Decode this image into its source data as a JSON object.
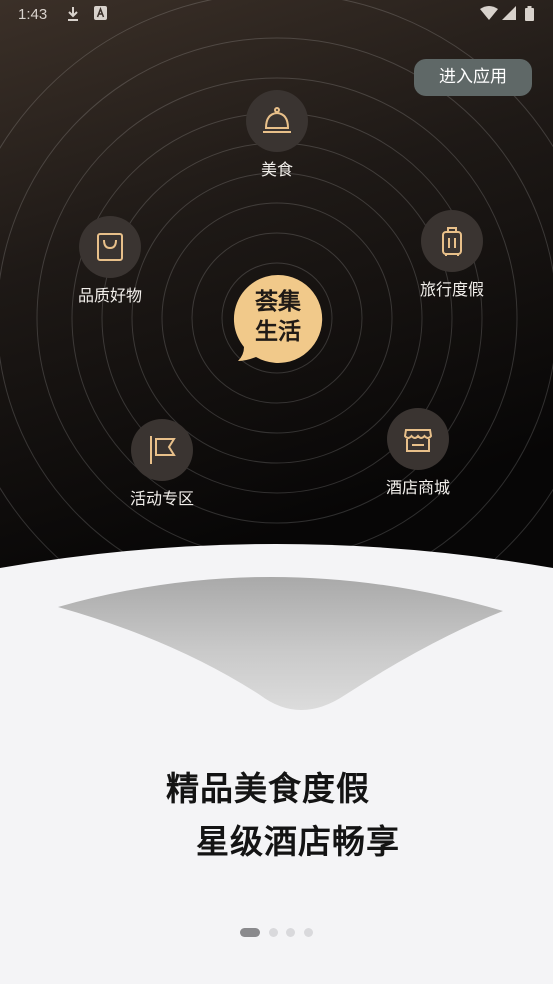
{
  "status_bar": {
    "time": "1:43",
    "left_icons": [
      "download-icon",
      "a-icon"
    ],
    "right_icons": [
      "wifi-icon",
      "signal-icon",
      "battery-icon"
    ]
  },
  "header": {
    "enter_app_label": "进入应用"
  },
  "center_logo": {
    "line1": "荟集",
    "line2": "生活"
  },
  "categories": [
    {
      "label": "美食",
      "icon": "service-bell-icon"
    },
    {
      "label": "品质好物",
      "icon": "shopping-bag-icon"
    },
    {
      "label": "旅行度假",
      "icon": "suitcase-icon"
    },
    {
      "label": "活动专区",
      "icon": "flag-icon"
    },
    {
      "label": "酒店商城",
      "icon": "storefront-icon"
    }
  ],
  "tagline": {
    "line1": "精品美食度假",
    "line2": "星级酒店畅享"
  },
  "pager": {
    "page_count": 4,
    "active_index": 0
  },
  "colors": {
    "dark_bg": "#1a1613",
    "accent_gold": "#f1c98a",
    "icon_stroke": "#e8c08a"
  }
}
